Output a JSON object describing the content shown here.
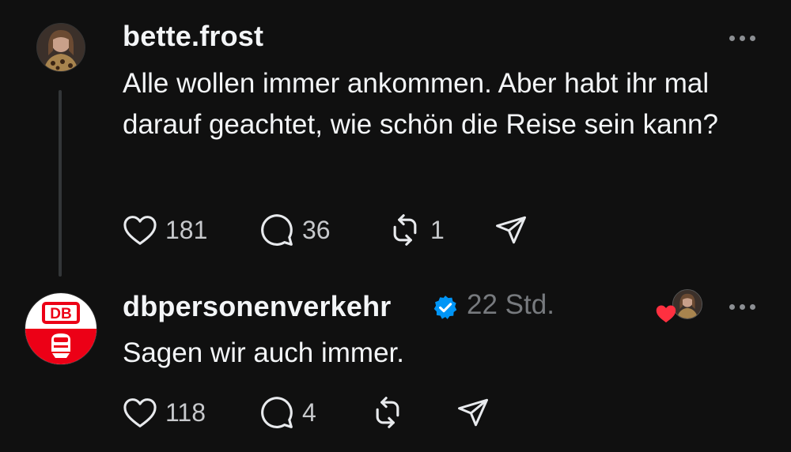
{
  "post": {
    "username": "bette.frost",
    "text": "Alle wollen immer ankommen. Aber habt ihr mal darauf geachtet, wie schön die Reise sein kann?",
    "likes": "181",
    "replies": "36",
    "reposts": "1"
  },
  "reply": {
    "username": "dbpersonenverkehr",
    "verified": true,
    "time": "22 Std.",
    "text": "Sagen wir auch immer.",
    "likes": "118",
    "replies": "4",
    "logo_text": "DB"
  },
  "colors": {
    "background": "#101010",
    "text": "#f3f5f7",
    "muted": "#777a7e",
    "verified": "#0095f6",
    "db_red": "#ec0016",
    "heart": "#ff3040"
  },
  "icons": [
    "heart-icon",
    "comment-icon",
    "repost-icon",
    "share-icon",
    "verified-icon",
    "more-icon"
  ]
}
